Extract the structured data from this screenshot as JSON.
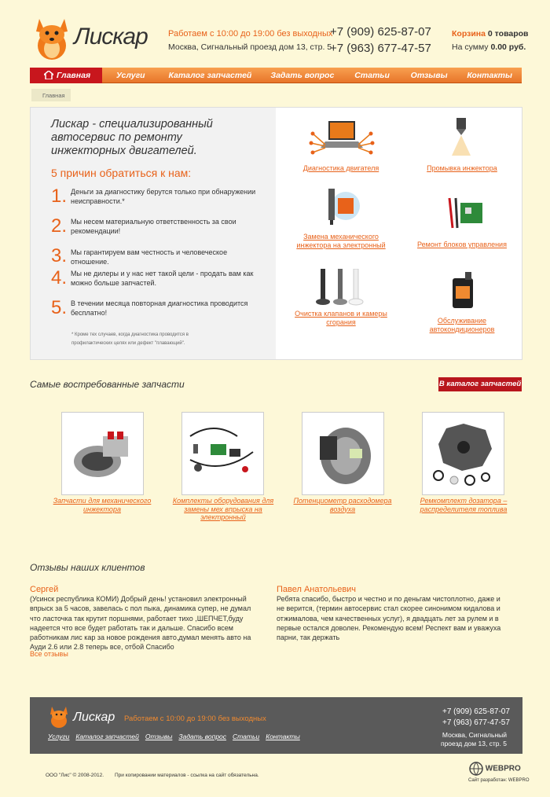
{
  "header": {
    "logo_text": "Лискар",
    "hours": "Работаем с 10:00 до 19:00 без выходных",
    "address": "Москва, Сигнальный проезд дом 13, стр. 5",
    "phone1": "+7 (909) 625-87-07",
    "phone2": "+7 (963) 677-47-57",
    "cart_link": "Корзина",
    "cart_count": "0 товаров",
    "cart_sum_label": "На сумму",
    "cart_sum": "0.00 руб."
  },
  "nav": [
    "Главная",
    "Услуги",
    "Каталог запчастей",
    "Задать вопрос",
    "Статьи",
    "Отзывы",
    "Контакты"
  ],
  "breadcrumb": "Главная",
  "intro": "Лискар - специализированный автосервис по ремонту инжекторных двигателей.",
  "reasons_title": "5 причин обратиться к нам:",
  "reasons": [
    {
      "num": "1.",
      "text": "Деньги за диагностику берутся только при обнаружении неисправности.*"
    },
    {
      "num": "2.",
      "text": "Мы несем материальную ответственность за свои рекомендации!"
    },
    {
      "num": "3.",
      "text": "Мы гарантируем вам честность и человеческое отношение."
    },
    {
      "num": "4.",
      "text": "Мы не дилеры и у нас нет такой цели - продать вам как можно больше запчастей."
    },
    {
      "num": "5.",
      "text": "В течении месяца повторная диагностика проводится бесплатно!"
    }
  ],
  "footnote": "* Кроме тех случаев, когда диагностика проводится в профилактических целях или дефект \"плавающий\".",
  "services": [
    "Диагностика двигателя",
    "Промывка инжектора",
    "Замена механического инжектора на электронный",
    "Ремонт блоков управления",
    "Очистка клапанов и камеры сгорания",
    "Обслуживание автокондиционеров"
  ],
  "parts_title": "Самые востребованные запчасти",
  "catalog_button": "В каталог запчастей",
  "parts": [
    "Запчасти для механического инжектора",
    "Комплекты оборудования для замены мех впрыска на электронный",
    "Потенциометр расходомера воздуха",
    "Ремкомплект дозатора – распределителя топлива"
  ],
  "reviews_title": "Отзывы наших клиентов",
  "reviews": [
    {
      "name": "Сергей",
      "text": "(Усинск республика КОМИ) Добрый день! установил электронный впрыск за 5 часов, завелась с пол пыка, динамика супер, не думал что ласточка так крутит поршнями, работает тихо ,ШЕПЧЕТ,буду надеется что все будет работать так и дальше. Спасибо всем работникам лис кар за новое рождения авто,думал менять авто на Ауди 2.6 или 2.8 теперь все, отбой Спасибо"
    },
    {
      "name": "Павел Анатольевич",
      "text": "Ребята спасибо, быстро и честно и по деньгам чистоплотно, даже и не верится, (термин автосервис стал скорее синонимом кидалова и отжималова, чем качественных услуг), я двадцать лет за рулем и в первые остался доволен. Рекомендую всем! Респект вам и уважуха парни, так держать"
    }
  ],
  "all_reviews": "Все отзывы",
  "footer": {
    "logo_text": "Лискар",
    "hours": "Работаем с 10:00 до 19:00 без выходных",
    "nav": [
      "Услуги",
      "Каталог запчастей",
      "Отзывы",
      "Задать вопрос",
      "Статьи",
      "Контакты"
    ],
    "phone1": "+7 (909) 625-87-07",
    "phone2": "+7 (963) 677-47-57",
    "address": "Москва, Сигнальный проезд дом 13, стр. 5",
    "copyright": "ООО \"Лис\" © 2008-2012.",
    "copy_note": "При копировании материалов - ссылка на сайт обязательна.",
    "dev_logo": "WEBPRO",
    "dev_note": "Сайт разработан: WEBPRO"
  },
  "colors": {
    "accent": "#e8621a",
    "nav": "#f08a38",
    "active": "#c8161d",
    "background": "#fdf8d8",
    "footer": "#5a5a5a"
  }
}
